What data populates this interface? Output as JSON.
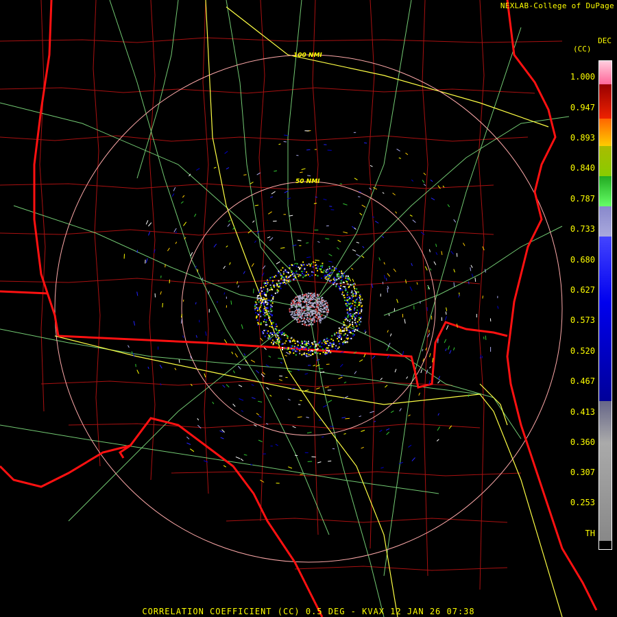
{
  "credit": "NEXLAB-College of DuPage",
  "product_header": {
    "line1": "DEC",
    "line2": "(CC)"
  },
  "footer_title": "CORRELATION COEFFICIENT (CC) 0.5 DEG - KVAX 12 JAN 26 07:38",
  "range_rings": [
    {
      "label": "100 NMI",
      "radius_nmi": 100
    },
    {
      "label": "50 NMI",
      "radius_nmi": 50
    }
  ],
  "color_scale": {
    "labels": [
      "1.000",
      "0.947",
      "0.893",
      "0.840",
      "0.787",
      "0.733",
      "0.680",
      "0.627",
      "0.573",
      "0.520",
      "0.467",
      "0.413",
      "0.360",
      "0.307",
      "0.253",
      "TH"
    ],
    "colors": {
      "pink": "#ff99cc",
      "red": "#cc0000",
      "orange": "#ff6600",
      "yellow": "#ffcc00",
      "yellow_green": "#aacc00",
      "green": "#33cc33",
      "lavender": "#9999cc",
      "blue": "#0000dd",
      "navy": "#000088",
      "gray": "#999999",
      "black": "#000000"
    }
  },
  "map_colors": {
    "state_borders": "#ff1111",
    "county_lines": "#aa0000",
    "highways": "#ffff44",
    "roads": "#88ee88",
    "range_rings": "#ffaaaa"
  }
}
